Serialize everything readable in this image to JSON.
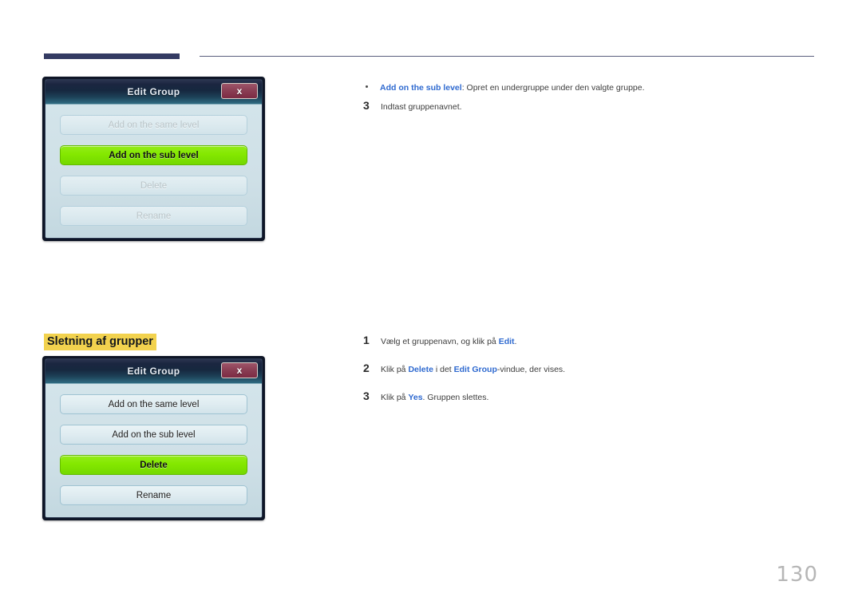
{
  "page": {
    "number": "130",
    "heading": "Sletning af grupper"
  },
  "dialogs": [
    {
      "title": "Edit Group",
      "close_label": "x",
      "buttons": [
        {
          "label": "Add on the same level",
          "state": "disabled"
        },
        {
          "label": "Add on the sub level",
          "state": "selected"
        },
        {
          "label": "Delete",
          "state": "disabled"
        },
        {
          "label": "Rename",
          "state": "disabled"
        }
      ]
    },
    {
      "title": "Edit Group",
      "close_label": "x",
      "buttons": [
        {
          "label": "Add on the same level",
          "state": "normal"
        },
        {
          "label": "Add on the sub level",
          "state": "normal"
        },
        {
          "label": "Delete",
          "state": "selected"
        },
        {
          "label": "Rename",
          "state": "normal"
        }
      ]
    }
  ],
  "instructions": {
    "bullet_1": {
      "term": "Add on the sub level",
      "rest": ": Opret en undergruppe under den valgte gruppe."
    },
    "step_1": {
      "number": "3",
      "text": "Indtast gruppenavnet."
    },
    "step_2": {
      "number": "1",
      "pre": "Vælg et gruppenavn, og klik på ",
      "term": "Edit",
      "post": "."
    },
    "step_3": {
      "number": "2",
      "pre": "Klik på ",
      "term": "Delete",
      "mid": " i det ",
      "term2": "Edit Group",
      "post": "-vindue, der vises."
    },
    "step_4": {
      "number": "3",
      "pre": "Klik på ",
      "term": "Yes",
      "post": ". Gruppen slettes."
    }
  },
  "colors": {
    "rule": "#343b63",
    "highlight": "#f2d24e",
    "link_blue": "#2f6ad0",
    "selected_green": "#84e800",
    "close_maroon": "#8b3f55"
  }
}
